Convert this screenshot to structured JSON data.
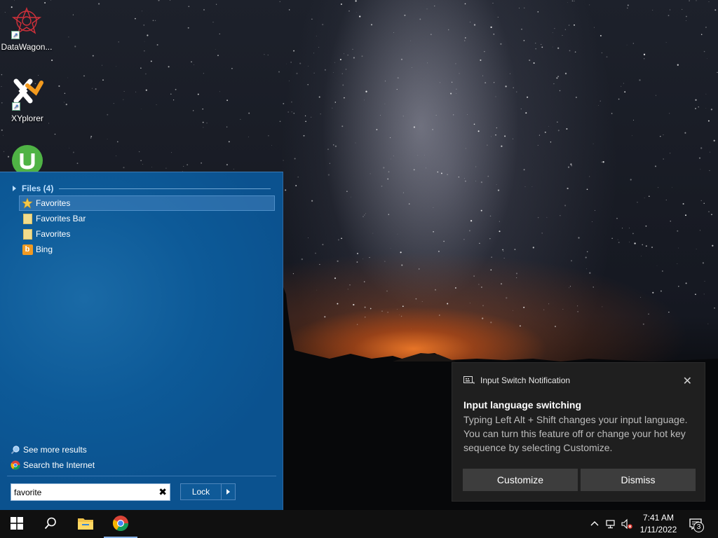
{
  "desktop": {
    "icons": [
      {
        "label": "DataWagon...",
        "icon": "datawagon-icon"
      },
      {
        "label": "XYplorer",
        "icon": "xyplorer-icon"
      },
      {
        "label": "",
        "icon": "utorrent-icon"
      }
    ]
  },
  "start_menu": {
    "group_header": "Files (4)",
    "results": [
      {
        "label": "Favorites",
        "icon": "star-icon",
        "selected": true
      },
      {
        "label": "Favorites Bar",
        "icon": "folder-icon",
        "selected": false
      },
      {
        "label": "Favorites",
        "icon": "folder-icon",
        "selected": false
      },
      {
        "label": "Bing",
        "icon": "bing-icon",
        "selected": false
      }
    ],
    "see_more": "See more results",
    "search_internet": "Search the Internet",
    "search_value": "favorite",
    "clear_symbol": "✖",
    "lock_label": "Lock"
  },
  "notification": {
    "app_name": "Input Switch Notification",
    "title": "Input language switching",
    "body": "Typing Left Alt + Shift changes your input language. You can turn this feature off or change your hot key sequence by selecting Customize.",
    "customize_label": "Customize",
    "dismiss_label": "Dismiss",
    "close_symbol": "✕"
  },
  "taskbar": {
    "time": "7:41 AM",
    "date": "1/11/2022",
    "notification_count": "3",
    "pinned": [
      "start-icon",
      "search-icon",
      "file-explorer-icon",
      "chrome-icon"
    ]
  }
}
